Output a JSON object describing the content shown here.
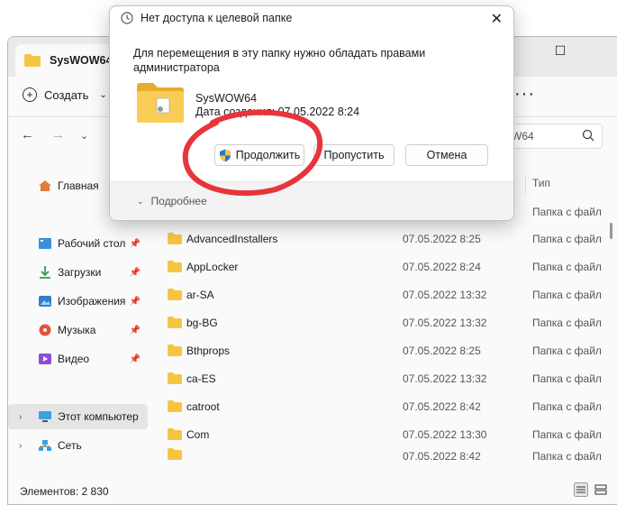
{
  "explorer": {
    "tab_title": "SysWOW64",
    "create_label": "Создать",
    "more_label": "···",
    "search_text": "W64",
    "columns": {
      "type": "Тип"
    },
    "sidebar": [
      {
        "label": "Главная"
      },
      {
        "label": "Рабочий стол"
      },
      {
        "label": "Загрузки"
      },
      {
        "label": "Изображения"
      },
      {
        "label": "Музыка"
      },
      {
        "label": "Видео"
      },
      {
        "label": "Этот компьютер"
      },
      {
        "label": "Сеть"
      }
    ],
    "files": [
      {
        "name": "AdvancedInstallers",
        "date": "07.05.2022 8:25",
        "type": "Папка с файл"
      },
      {
        "name": "AppLocker",
        "date": "07.05.2022 8:24",
        "type": "Папка с файл"
      },
      {
        "name": "ar-SA",
        "date": "07.05.2022 13:32",
        "type": "Папка с файл"
      },
      {
        "name": "bg-BG",
        "date": "07.05.2022 13:32",
        "type": "Папка с файл"
      },
      {
        "name": "Bthprops",
        "date": "07.05.2022 8:25",
        "type": "Папка с файл"
      },
      {
        "name": "ca-ES",
        "date": "07.05.2022 13:32",
        "type": "Папка с файл"
      },
      {
        "name": "catroot",
        "date": "07.05.2022 8:42",
        "type": "Папка с файл"
      },
      {
        "name": "Com",
        "date": "07.05.2022 13:30",
        "type": "Папка с файл"
      }
    ],
    "partial_row": {
      "date": "07.05.2022 8:42",
      "type": "Папка с файл"
    },
    "type_header_row": "Папка с файл",
    "status": "Элементов: 2 830"
  },
  "dialog": {
    "title": "Нет доступа к целевой папке",
    "message": "Для перемещения в эту папку нужно обладать правами администратора",
    "folder_name": "SysWOW64",
    "folder_date": "Дата создания: 07.05.2022 8:24",
    "btn_continue": "Продолжить",
    "btn_skip": "Пропустить",
    "btn_cancel": "Отмена",
    "details": "Подробнее"
  },
  "colors": {
    "annotation": "#e8343a",
    "folder": "#f5c542",
    "accent": "#0067c0"
  }
}
